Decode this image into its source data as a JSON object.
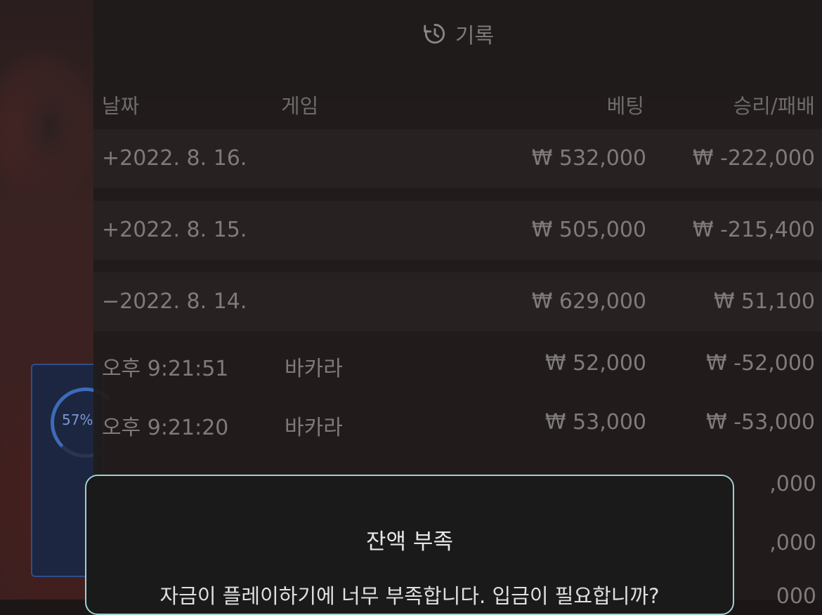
{
  "timer": {
    "percent": "57%"
  },
  "header": {
    "icon": "history-icon",
    "title": "기록"
  },
  "columns": {
    "date": "날짜",
    "game": "게임",
    "bet": "베팅",
    "result": "승리/패배"
  },
  "days": [
    {
      "date": "+2022. 8. 16.",
      "bet": "₩ 532,000",
      "result": "₩ -222,000"
    },
    {
      "date": "+2022. 8. 15.",
      "bet": "₩ 505,000",
      "result": "₩ -215,400"
    },
    {
      "date": "−2022. 8. 14.",
      "bet": "₩ 629,000",
      "result": "₩ 51,100"
    }
  ],
  "rounds": [
    {
      "time": "오후 9:21:51",
      "game": "바카라",
      "bet": "₩ 52,000",
      "result": "₩ -52,000"
    },
    {
      "time": "오후 9:21:20",
      "game": "바카라",
      "bet": "₩ 53,000",
      "result": "₩ -53,000"
    }
  ],
  "peek_values": [
    ",000",
    ",000",
    "000"
  ],
  "modal": {
    "title": "잔액 부족",
    "message": "자금이 플레이하기에 너무 부족합니다. 입금이 필요합니까?"
  },
  "colors": {
    "modal_border": "#9fd0d0",
    "timer_blue": "#3d6bb8"
  }
}
